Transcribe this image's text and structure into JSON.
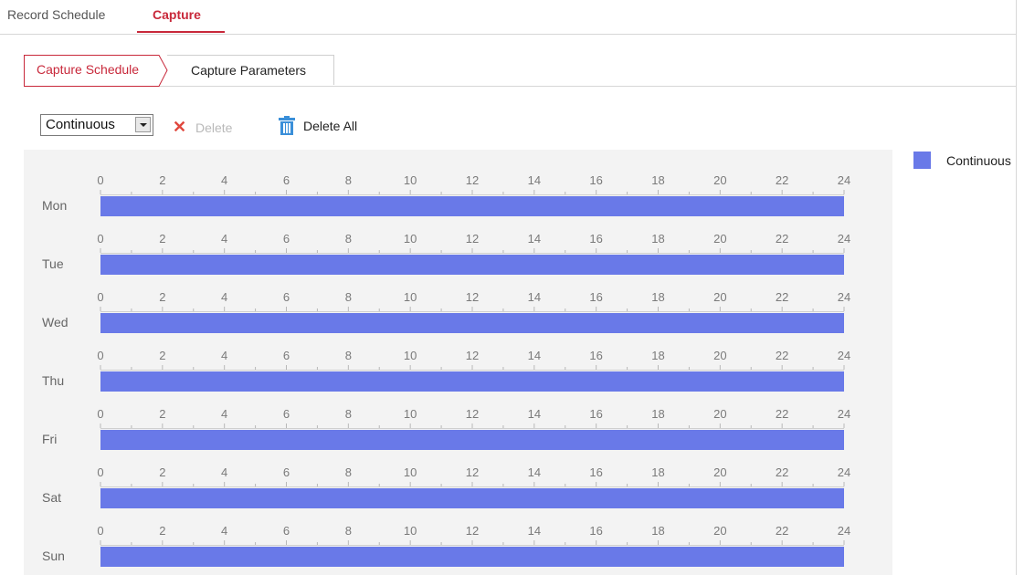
{
  "top_tabs": [
    {
      "label": "Record Schedule",
      "active": false
    },
    {
      "label": "Capture",
      "active": true
    }
  ],
  "sub_tabs": [
    {
      "label": "Capture Schedule",
      "active": true
    },
    {
      "label": "Capture Parameters",
      "active": false
    }
  ],
  "toolbar": {
    "mode_select_value": "Continuous",
    "delete_label": "Delete",
    "delete_enabled": false,
    "delete_all_label": "Delete All"
  },
  "schedule": {
    "hour_ticks": [
      "0",
      "2",
      "4",
      "6",
      "8",
      "10",
      "12",
      "14",
      "16",
      "18",
      "20",
      "22",
      "24"
    ],
    "days": [
      {
        "label": "Mon",
        "segments": [
          {
            "start": 0,
            "end": 24,
            "type": "Continuous"
          }
        ]
      },
      {
        "label": "Tue",
        "segments": [
          {
            "start": 0,
            "end": 24,
            "type": "Continuous"
          }
        ]
      },
      {
        "label": "Wed",
        "segments": [
          {
            "start": 0,
            "end": 24,
            "type": "Continuous"
          }
        ]
      },
      {
        "label": "Thu",
        "segments": [
          {
            "start": 0,
            "end": 24,
            "type": "Continuous"
          }
        ]
      },
      {
        "label": "Fri",
        "segments": [
          {
            "start": 0,
            "end": 24,
            "type": "Continuous"
          }
        ]
      },
      {
        "label": "Sat",
        "segments": [
          {
            "start": 0,
            "end": 24,
            "type": "Continuous"
          }
        ]
      },
      {
        "label": "Sun",
        "segments": [
          {
            "start": 0,
            "end": 24,
            "type": "Continuous"
          }
        ]
      }
    ]
  },
  "legend": [
    {
      "label": "Continuous",
      "color": "#6979e8"
    }
  ],
  "colors": {
    "accent": "#c8283a",
    "continuous": "#6979e8",
    "delete_x": "#e0473d",
    "trash": "#3a8fd9"
  },
  "icons": {
    "delete": "close-icon",
    "delete_all": "trash-icon",
    "dropdown": "chevron-down-icon"
  }
}
